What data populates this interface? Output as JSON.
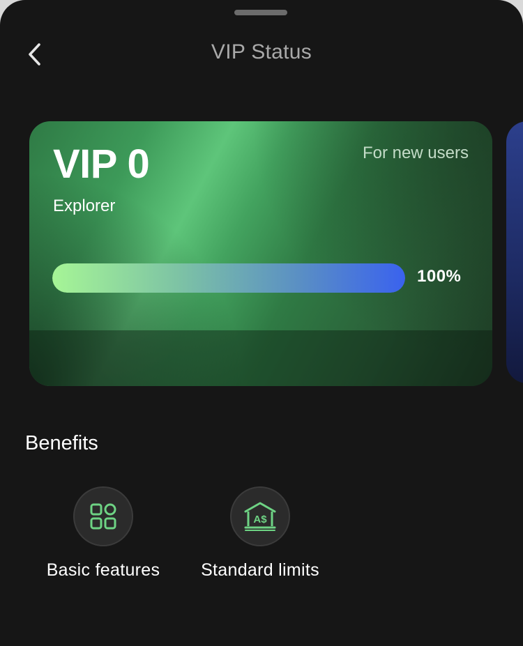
{
  "header": {
    "title": "VIP Status",
    "back_icon": "chevron-left-icon"
  },
  "vip_card": {
    "level": "VIP 0",
    "tag": "For new users",
    "name": "Explorer",
    "progress_percent": 100,
    "progress_label": "100%",
    "gradient_colors": [
      "#5ec57a",
      "#2f7a44",
      "#1d3a24"
    ],
    "progress_colors": [
      "#a6f596",
      "#3a62ee"
    ]
  },
  "next_card": {
    "color": "#2c3f8c"
  },
  "benefits": {
    "title": "Benefits",
    "items": [
      {
        "label": "Basic features",
        "icon": "grid-icon"
      },
      {
        "label": "Standard limits",
        "icon": "bank-icon",
        "icon_text": "A$"
      }
    ]
  },
  "colors": {
    "background": "#161616",
    "accent_green": "#6ed384",
    "muted_text": "#a9a9a9"
  }
}
